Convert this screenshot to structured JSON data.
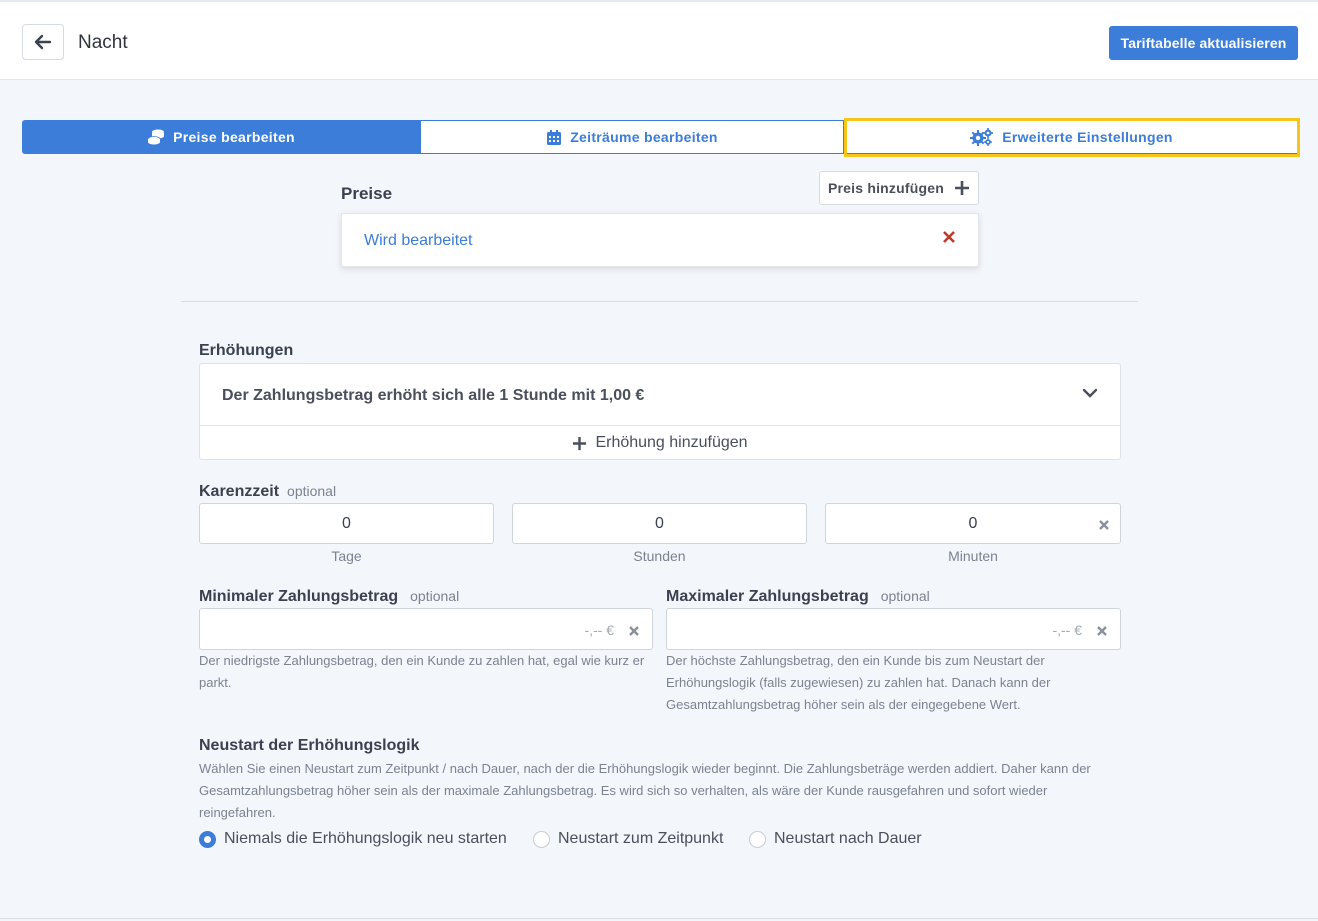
{
  "header": {
    "title": "Nacht",
    "update_button": "Tariftabelle aktualisieren"
  },
  "tabs": [
    {
      "label": "Preise bearbeiten",
      "icon": "coins-icon",
      "active": true
    },
    {
      "label": "Zeiträume bearbeiten",
      "icon": "calendar-icon",
      "active": false
    },
    {
      "label": "Erweiterte Einstellungen",
      "icon": "gears-icon",
      "active": false
    }
  ],
  "prices": {
    "label": "Preise",
    "add_button": "Preis hinzufügen",
    "items": [
      {
        "label": "Wird bearbeitet"
      }
    ]
  },
  "raises": {
    "label": "Erhöhungen",
    "rule": "Der Zahlungsbetrag erhöht sich alle 1 Stunde mit 1,00 €",
    "add_label": "Erhöhung hinzufügen"
  },
  "grace": {
    "label": "Karenzzeit",
    "optional": "optional",
    "days": {
      "value": "0",
      "unit": "Tage"
    },
    "hours": {
      "value": "0",
      "unit": "Stunden"
    },
    "minutes": {
      "value": "0",
      "unit": "Minuten"
    }
  },
  "min_amount": {
    "label": "Minimaler Zahlungsbetrag",
    "optional": "optional",
    "placeholder": "-,-- €",
    "help": "Der niedrigste Zahlungsbetrag, den ein Kunde zu zahlen hat, egal wie kurz er parkt."
  },
  "max_amount": {
    "label": "Maximaler Zahlungsbetrag",
    "optional": "optional",
    "placeholder": "-,-- €",
    "help": "Der höchste Zahlungsbetrag, den ein Kunde bis zum Neustart der Erhöhungslogik (falls zugewiesen) zu zahlen hat. Danach kann der Gesamtzahlungsbetrag höher sein als der eingegebene Wert."
  },
  "restart": {
    "label": "Neustart der Erhöhungslogik",
    "help": "Wählen Sie einen Neustart zum Zeitpunkt / nach Dauer, nach der die Erhöhungslogik wieder beginnt. Die Zahlungsbeträge werden addiert. Daher kann der Gesamtzahlungsbetrag höher sein als der maximale Zahlungsbetrag. Es wird sich so verhalten, als wäre der Kunde rausgefahren und sofort wieder reingefahren.",
    "options": [
      {
        "label": "Niemals die Erhöhungslogik neu starten",
        "selected": true
      },
      {
        "label": "Neustart zum Zeitpunkt",
        "selected": false
      },
      {
        "label": "Neustart nach Dauer",
        "selected": false
      }
    ]
  },
  "colors": {
    "accent": "#3b7dd8",
    "highlight": "#f5c518",
    "danger": "#c0392b"
  }
}
